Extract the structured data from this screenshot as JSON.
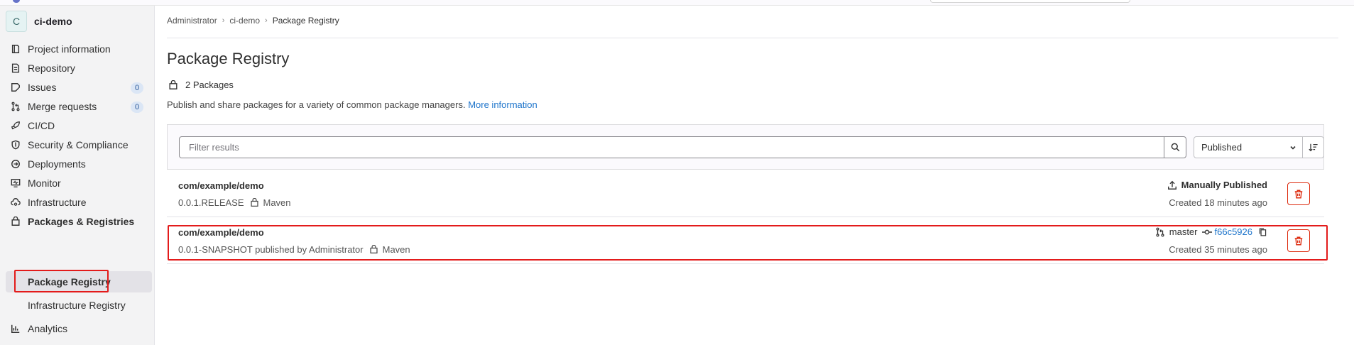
{
  "project": {
    "avatar_letter": "C",
    "name": "ci-demo"
  },
  "sidebar": {
    "items": [
      {
        "label": "Project information",
        "icon": "project-icon"
      },
      {
        "label": "Repository",
        "icon": "repository-icon"
      },
      {
        "label": "Issues",
        "icon": "issues-icon",
        "badge": "0"
      },
      {
        "label": "Merge requests",
        "icon": "merge-request-icon",
        "badge": "0"
      },
      {
        "label": "CI/CD",
        "icon": "rocket-icon"
      },
      {
        "label": "Security & Compliance",
        "icon": "shield-icon"
      },
      {
        "label": "Deployments",
        "icon": "deployments-icon"
      },
      {
        "label": "Monitor",
        "icon": "monitor-icon"
      },
      {
        "label": "Infrastructure",
        "icon": "cloud-gear-icon"
      },
      {
        "label": "Packages & Registries",
        "icon": "package-icon"
      },
      {
        "label": "Analytics",
        "icon": "chart-icon"
      }
    ],
    "sub_items": [
      {
        "label": "Package Registry",
        "active": true
      },
      {
        "label": "Infrastructure Registry",
        "active": false
      }
    ]
  },
  "breadcrumb": [
    "Administrator",
    "ci-demo",
    "Package Registry"
  ],
  "page": {
    "title": "Package Registry",
    "count": "2 Packages",
    "description": "Publish and share packages for a variety of common package managers.",
    "more_link": "More information"
  },
  "filter": {
    "placeholder": "Filter results",
    "sort_value": "Published"
  },
  "packages": [
    {
      "name": "com/example/demo",
      "version": "0.0.1.RELEASE",
      "type": "Maven",
      "published_by": "",
      "status": "Manually Published",
      "created": "Created 18 minutes ago"
    },
    {
      "name": "com/example/demo",
      "version": "0.0.1-SNAPSHOT published by Administrator",
      "type": "Maven",
      "branch": "master",
      "commit": "f66c5926",
      "created": "Created 35 minutes ago"
    }
  ],
  "colors": {
    "accent_link": "#1f75cb",
    "danger": "#dd2b0e",
    "highlight_box": "#e31b1b"
  }
}
